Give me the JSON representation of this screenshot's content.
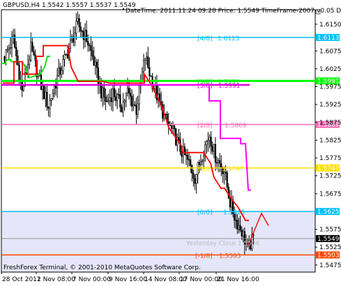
{
  "header": {
    "symbol_line": "GBPUSD,H4  1.5542 1.5557 1.5537 1.5549",
    "info_line": "DateTime: 2011.11.24 09:28   Price: 1.5549   TimeFrame-2007-v0.05   Def-"
  },
  "footer": {
    "copyright": "FreshForex Terminal, © 2001-2010 MetaQuotes Software Corp."
  },
  "colors": {
    "background": "#ffffff",
    "shade_zone": "#e6e6fa",
    "candle": "#000000",
    "red_line": "#ff0000",
    "green_line": "#00e000",
    "magenta_line": "#ff00ff",
    "level_8": "#00bfff",
    "level_6": "#00ff00",
    "level_5": "#e000e0",
    "level_4": "#00bfff",
    "level_3": "#ff69b4",
    "level_2": "#ffe000",
    "level_0": "#00bfff",
    "level_minus1": "#ff4500",
    "current_price_bg": "#000000"
  },
  "chart_data": {
    "type": "candlestick",
    "symbol": "GBPUSD",
    "timeframe": "H4",
    "ohlc": {
      "open": 1.5542,
      "high": 1.5557,
      "low": 1.5537,
      "close": 1.5549
    },
    "y_range": [
      1.5455,
      1.6175
    ],
    "y_ticks": [
      "1.6150",
      "1.6075",
      "1.6025",
      "1.5975",
      "1.5925",
      "1.5875",
      "1.5825",
      "1.5775",
      "1.5725",
      "1.5675",
      "1.5575",
      "1.5525",
      "1.5475"
    ],
    "x_tick_labels": [
      "28 Oct 2011",
      "2 Nov 08:00",
      "7 Nov 00:00",
      "9 Nov 16:00",
      "14 Nov 08:00",
      "17 Nov 00:00",
      "21 Nov 16:00"
    ],
    "murrey_levels": [
      {
        "label": "[4/8]",
        "value_text": "1.6113",
        "price": 1.6113,
        "color": "#00bfff",
        "axis_tag": "1.6113"
      },
      {
        "label": "[3/8]",
        "value_text": "1.5991",
        "price": 1.5991,
        "color": "#00ff00",
        "axis_tag": "1.5991"
      },
      {
        "label": "[2/8]",
        "value_text": "1.5869",
        "price": 1.5869,
        "color": "#ff69b4",
        "axis_tag": "1.5869"
      },
      {
        "label": "[1/8]",
        "value_text": "1.5747",
        "price": 1.5747,
        "color": "#ffe000",
        "axis_tag": "1.5747"
      },
      {
        "label": "[0/8]",
        "value_text": "1.5625",
        "price": 1.5625,
        "color": "#00bfff",
        "axis_tag": "1.5625"
      },
      {
        "label": "[-1/8]",
        "value_text": "1.5503",
        "price": 1.5503,
        "color": "#ff4500",
        "axis_tag": "1.5503"
      }
    ],
    "extra_level": {
      "label": "[3/8]",
      "value_text": "1.5991",
      "price": 1.598,
      "color": "#e000e0"
    },
    "yesterday_close_label": "Yesterday Close 1.5536",
    "current_price": {
      "value": 1.5549,
      "text": "1.5549"
    },
    "shaded_zone": {
      "from": 1.5455,
      "to": 1.5625
    }
  }
}
